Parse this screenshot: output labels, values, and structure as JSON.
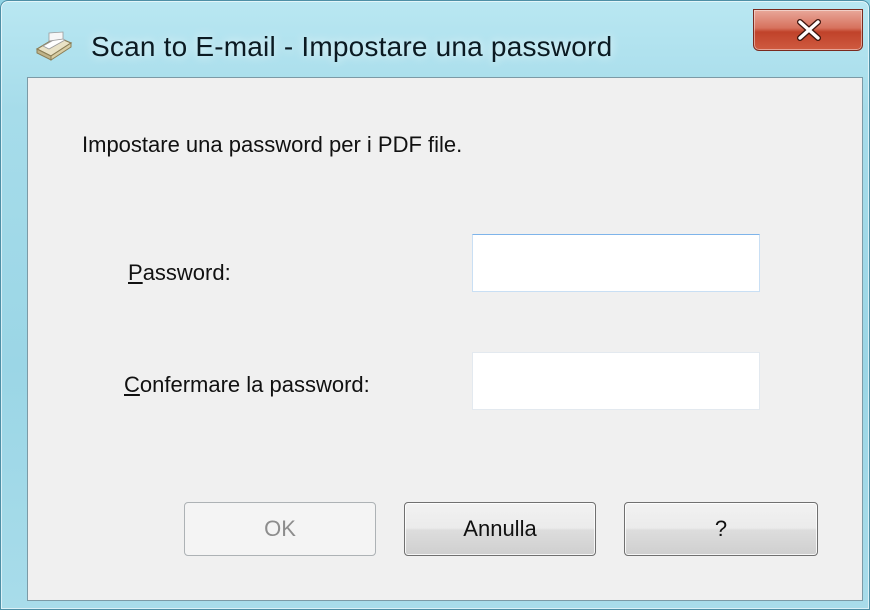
{
  "window": {
    "title": "Scan to E-mail - Impostare una password",
    "app_icon": "scanner-icon",
    "close_icon": "close-icon",
    "close_color": "#c0422a"
  },
  "dialog": {
    "instruction": "Impostare una password per i PDF file.",
    "password_label_mnemonic": "P",
    "password_label_rest": "assword:",
    "password_value": "",
    "confirm_label_mnemonic": "C",
    "confirm_label_rest": "onfermare la password:",
    "confirm_value": ""
  },
  "buttons": {
    "ok": "OK",
    "ok_enabled": false,
    "cancel": "Annulla",
    "help": "?"
  }
}
